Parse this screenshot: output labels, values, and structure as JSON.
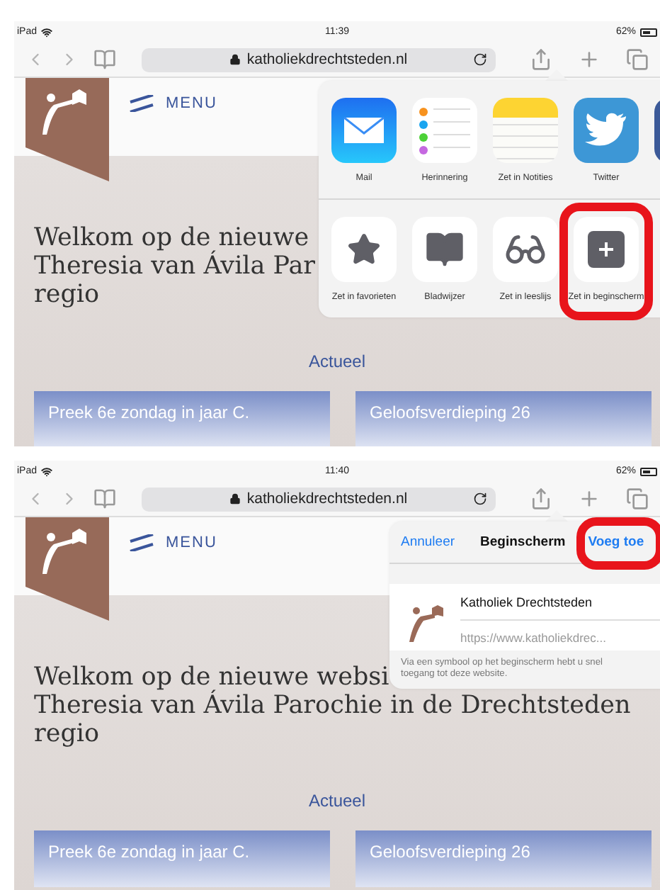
{
  "screenshots": [
    {
      "status_bar": {
        "device": "iPad",
        "time": "11:39",
        "battery": "62%"
      },
      "address_bar": {
        "url": "katholiekdrechtsteden.nl"
      },
      "site": {
        "menu": "MENU",
        "headline": [
          "Welkom op de nieuwe",
          "Theresia van Ávila Par",
          "regio"
        ],
        "section": "Actueel",
        "cards": [
          "Preek 6e zondag in jaar C.",
          "Geloofsverdieping 26"
        ]
      },
      "overlay": {
        "kind": "share",
        "apps": [
          {
            "kind": "mail",
            "label": "Mail"
          },
          {
            "kind": "reminders",
            "label": "Herinnering"
          },
          {
            "kind": "notes",
            "label": "Zet in Notities"
          },
          {
            "kind": "twitter",
            "label": "Twitter"
          },
          {
            "kind": "app"
          }
        ],
        "actions": [
          {
            "kind": "star",
            "label": "Zet in favorieten",
            "highlighted": false
          },
          {
            "kind": "book",
            "label": "Bladwijzer",
            "highlighted": false
          },
          {
            "kind": "glasses",
            "label": "Zet in leeslijs",
            "highlighted": false
          },
          {
            "kind": "plus",
            "label": "Zet in beginscherm",
            "highlighted": true
          }
        ]
      }
    },
    {
      "status_bar": {
        "device": "iPad",
        "time": "11:40",
        "battery": "62%"
      },
      "address_bar": {
        "url": "katholiekdrechtsteden.nl"
      },
      "site": {
        "menu": "MENU",
        "headline": [
          "Welkom op de nieuwe websi",
          "Theresia van Ávila Parochie in de Drechtsteden",
          "regio"
        ],
        "section": "Actueel",
        "cards": [
          "Preek 6e zondag in jaar C.",
          "Geloofsverdieping 26"
        ]
      },
      "overlay": {
        "kind": "add_home",
        "cancel": "Annuleer",
        "title": "Beginscherm",
        "confirm": "Voeg toe",
        "confirm_highlighted": true,
        "name": "Katholiek Drechtsteden",
        "url": "https://www.katholiekdrec...",
        "note": "Via een symbool op het beginscherm hebt u snel toegang tot deze website."
      }
    }
  ]
}
